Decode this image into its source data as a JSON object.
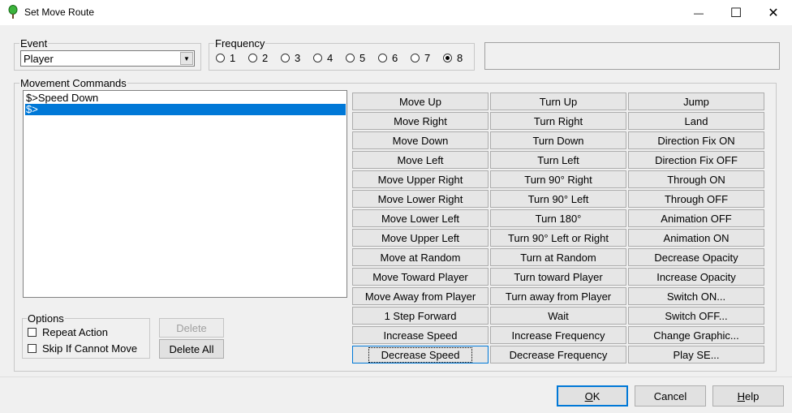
{
  "window": {
    "title": "Set Move Route",
    "minimize_glyph": "—",
    "maximize_glyph": "☐",
    "close_glyph": "✕",
    "icon": "green-pin-icon"
  },
  "event": {
    "label": "Event",
    "selected": "Player",
    "arrow": "▼"
  },
  "frequency": {
    "label": "Frequency",
    "options": [
      "1",
      "2",
      "3",
      "4",
      "5",
      "6",
      "7",
      "8"
    ],
    "selected": "8"
  },
  "movement": {
    "label": "Movement Commands",
    "list": [
      "$>Speed Down",
      "$>"
    ],
    "selected_index": 1
  },
  "commands": {
    "col1": [
      "Move Up",
      "Move Right",
      "Move Down",
      "Move Left",
      "Move Upper Right",
      "Move Lower Right",
      "Move Lower Left",
      "Move Upper Left",
      "Move at Random",
      "Move Toward Player",
      "Move Away from Player",
      "1 Step Forward",
      "Increase Speed",
      "Decrease Speed"
    ],
    "col2": [
      "Turn Up",
      "Turn Right",
      "Turn Down",
      "Turn Left",
      "Turn 90° Right",
      "Turn 90° Left",
      "Turn 180°",
      "Turn 90° Left or Right",
      "Turn at Random",
      "Turn toward Player",
      "Turn away from Player",
      "Wait",
      "Increase Frequency",
      "Decrease Frequency"
    ],
    "col3": [
      "Jump",
      "Land",
      "Direction Fix ON",
      "Direction Fix OFF",
      "Through ON",
      "Through OFF",
      "Animation OFF",
      "Animation ON",
      "Decrease Opacity",
      "Increase Opacity",
      "Switch ON...",
      "Switch OFF...",
      "Change Graphic...",
      "Play SE..."
    ]
  },
  "options": {
    "label": "Options",
    "repeat_action": "Repeat Action",
    "skip_if_cannot_move": "Skip If Cannot Move"
  },
  "buttons": {
    "delete": "Delete",
    "delete_all": "Delete All",
    "ok": "OK",
    "cancel": "Cancel",
    "help": "Help"
  }
}
